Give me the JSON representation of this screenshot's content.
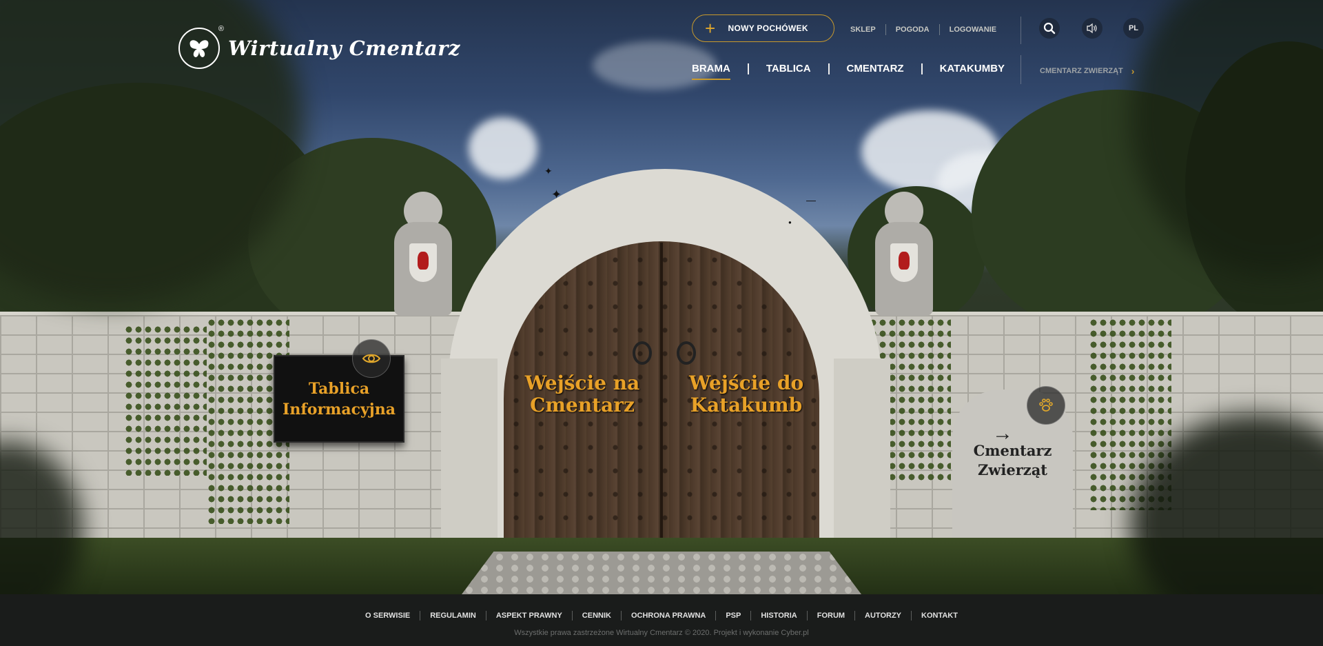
{
  "header": {
    "logo_text": "Wirtualny Cmentarz",
    "logo_reg": "®",
    "new_burial_label": "NOWY POCHÓWEK",
    "top_links": [
      "SKLEP",
      "POGODA",
      "LOGOWANIE"
    ],
    "lang": "PL",
    "icons": {
      "search": "search-icon",
      "sound": "speaker-icon"
    },
    "nav": [
      {
        "label": "BRAMA",
        "active": true
      },
      {
        "label": "TABLICA",
        "active": false
      },
      {
        "label": "CMENTARZ",
        "active": false
      },
      {
        "label": "KATAKUMBY",
        "active": false
      }
    ],
    "pet_cemetery_link": "CMENTARZ ZWIERZĄT"
  },
  "scene": {
    "info_board": {
      "line1": "Tablica",
      "line2": "Informacyjna",
      "icon": "eye-icon"
    },
    "door_left": {
      "line1": "Wejście na",
      "line2": "Cmentarz"
    },
    "door_right": {
      "line1": "Wejście do",
      "line2": "Katakumb"
    },
    "tomb": {
      "line1": "Cmentarz",
      "line2": "Zwierząt",
      "arrow": "→",
      "icon": "paw-icon"
    }
  },
  "footer": {
    "links": [
      "O SERWISIE",
      "REGULAMIN",
      "ASPEKT PRAWNY",
      "CENNIK",
      "OCHRONA PRAWNA",
      "PSP",
      "HISTORIA",
      "FORUM",
      "AUTORZY",
      "KONTAKT"
    ],
    "copyright": "Wszystkie prawa zastrzeżone Wirtualny Cmentarz © 2020. Projekt i wykonanie Cyber.pl"
  },
  "colors": {
    "accent": "#c99a2c",
    "label_gold": "#e8a128",
    "footer_bg": "#1a1c1b"
  }
}
